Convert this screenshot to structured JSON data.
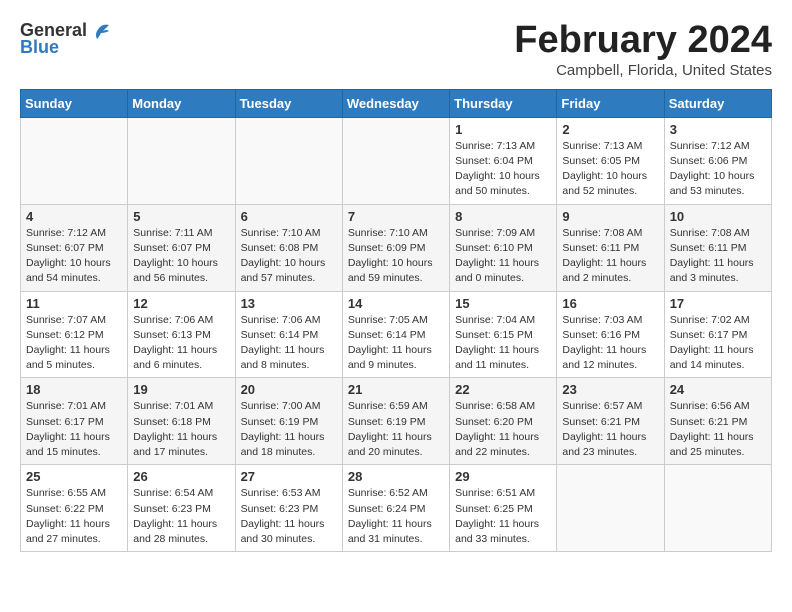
{
  "header": {
    "logo_general": "General",
    "logo_blue": "Blue",
    "month_title": "February 2024",
    "location": "Campbell, Florida, United States"
  },
  "days_of_week": [
    "Sunday",
    "Monday",
    "Tuesday",
    "Wednesday",
    "Thursday",
    "Friday",
    "Saturday"
  ],
  "weeks": [
    [
      {
        "day": "",
        "info": ""
      },
      {
        "day": "",
        "info": ""
      },
      {
        "day": "",
        "info": ""
      },
      {
        "day": "",
        "info": ""
      },
      {
        "day": "1",
        "info": "Sunrise: 7:13 AM\nSunset: 6:04 PM\nDaylight: 10 hours\nand 50 minutes."
      },
      {
        "day": "2",
        "info": "Sunrise: 7:13 AM\nSunset: 6:05 PM\nDaylight: 10 hours\nand 52 minutes."
      },
      {
        "day": "3",
        "info": "Sunrise: 7:12 AM\nSunset: 6:06 PM\nDaylight: 10 hours\nand 53 minutes."
      }
    ],
    [
      {
        "day": "4",
        "info": "Sunrise: 7:12 AM\nSunset: 6:07 PM\nDaylight: 10 hours\nand 54 minutes."
      },
      {
        "day": "5",
        "info": "Sunrise: 7:11 AM\nSunset: 6:07 PM\nDaylight: 10 hours\nand 56 minutes."
      },
      {
        "day": "6",
        "info": "Sunrise: 7:10 AM\nSunset: 6:08 PM\nDaylight: 10 hours\nand 57 minutes."
      },
      {
        "day": "7",
        "info": "Sunrise: 7:10 AM\nSunset: 6:09 PM\nDaylight: 10 hours\nand 59 minutes."
      },
      {
        "day": "8",
        "info": "Sunrise: 7:09 AM\nSunset: 6:10 PM\nDaylight: 11 hours\nand 0 minutes."
      },
      {
        "day": "9",
        "info": "Sunrise: 7:08 AM\nSunset: 6:11 PM\nDaylight: 11 hours\nand 2 minutes."
      },
      {
        "day": "10",
        "info": "Sunrise: 7:08 AM\nSunset: 6:11 PM\nDaylight: 11 hours\nand 3 minutes."
      }
    ],
    [
      {
        "day": "11",
        "info": "Sunrise: 7:07 AM\nSunset: 6:12 PM\nDaylight: 11 hours\nand 5 minutes."
      },
      {
        "day": "12",
        "info": "Sunrise: 7:06 AM\nSunset: 6:13 PM\nDaylight: 11 hours\nand 6 minutes."
      },
      {
        "day": "13",
        "info": "Sunrise: 7:06 AM\nSunset: 6:14 PM\nDaylight: 11 hours\nand 8 minutes."
      },
      {
        "day": "14",
        "info": "Sunrise: 7:05 AM\nSunset: 6:14 PM\nDaylight: 11 hours\nand 9 minutes."
      },
      {
        "day": "15",
        "info": "Sunrise: 7:04 AM\nSunset: 6:15 PM\nDaylight: 11 hours\nand 11 minutes."
      },
      {
        "day": "16",
        "info": "Sunrise: 7:03 AM\nSunset: 6:16 PM\nDaylight: 11 hours\nand 12 minutes."
      },
      {
        "day": "17",
        "info": "Sunrise: 7:02 AM\nSunset: 6:17 PM\nDaylight: 11 hours\nand 14 minutes."
      }
    ],
    [
      {
        "day": "18",
        "info": "Sunrise: 7:01 AM\nSunset: 6:17 PM\nDaylight: 11 hours\nand 15 minutes."
      },
      {
        "day": "19",
        "info": "Sunrise: 7:01 AM\nSunset: 6:18 PM\nDaylight: 11 hours\nand 17 minutes."
      },
      {
        "day": "20",
        "info": "Sunrise: 7:00 AM\nSunset: 6:19 PM\nDaylight: 11 hours\nand 18 minutes."
      },
      {
        "day": "21",
        "info": "Sunrise: 6:59 AM\nSunset: 6:19 PM\nDaylight: 11 hours\nand 20 minutes."
      },
      {
        "day": "22",
        "info": "Sunrise: 6:58 AM\nSunset: 6:20 PM\nDaylight: 11 hours\nand 22 minutes."
      },
      {
        "day": "23",
        "info": "Sunrise: 6:57 AM\nSunset: 6:21 PM\nDaylight: 11 hours\nand 23 minutes."
      },
      {
        "day": "24",
        "info": "Sunrise: 6:56 AM\nSunset: 6:21 PM\nDaylight: 11 hours\nand 25 minutes."
      }
    ],
    [
      {
        "day": "25",
        "info": "Sunrise: 6:55 AM\nSunset: 6:22 PM\nDaylight: 11 hours\nand 27 minutes."
      },
      {
        "day": "26",
        "info": "Sunrise: 6:54 AM\nSunset: 6:23 PM\nDaylight: 11 hours\nand 28 minutes."
      },
      {
        "day": "27",
        "info": "Sunrise: 6:53 AM\nSunset: 6:23 PM\nDaylight: 11 hours\nand 30 minutes."
      },
      {
        "day": "28",
        "info": "Sunrise: 6:52 AM\nSunset: 6:24 PM\nDaylight: 11 hours\nand 31 minutes."
      },
      {
        "day": "29",
        "info": "Sunrise: 6:51 AM\nSunset: 6:25 PM\nDaylight: 11 hours\nand 33 minutes."
      },
      {
        "day": "",
        "info": ""
      },
      {
        "day": "",
        "info": ""
      }
    ]
  ]
}
